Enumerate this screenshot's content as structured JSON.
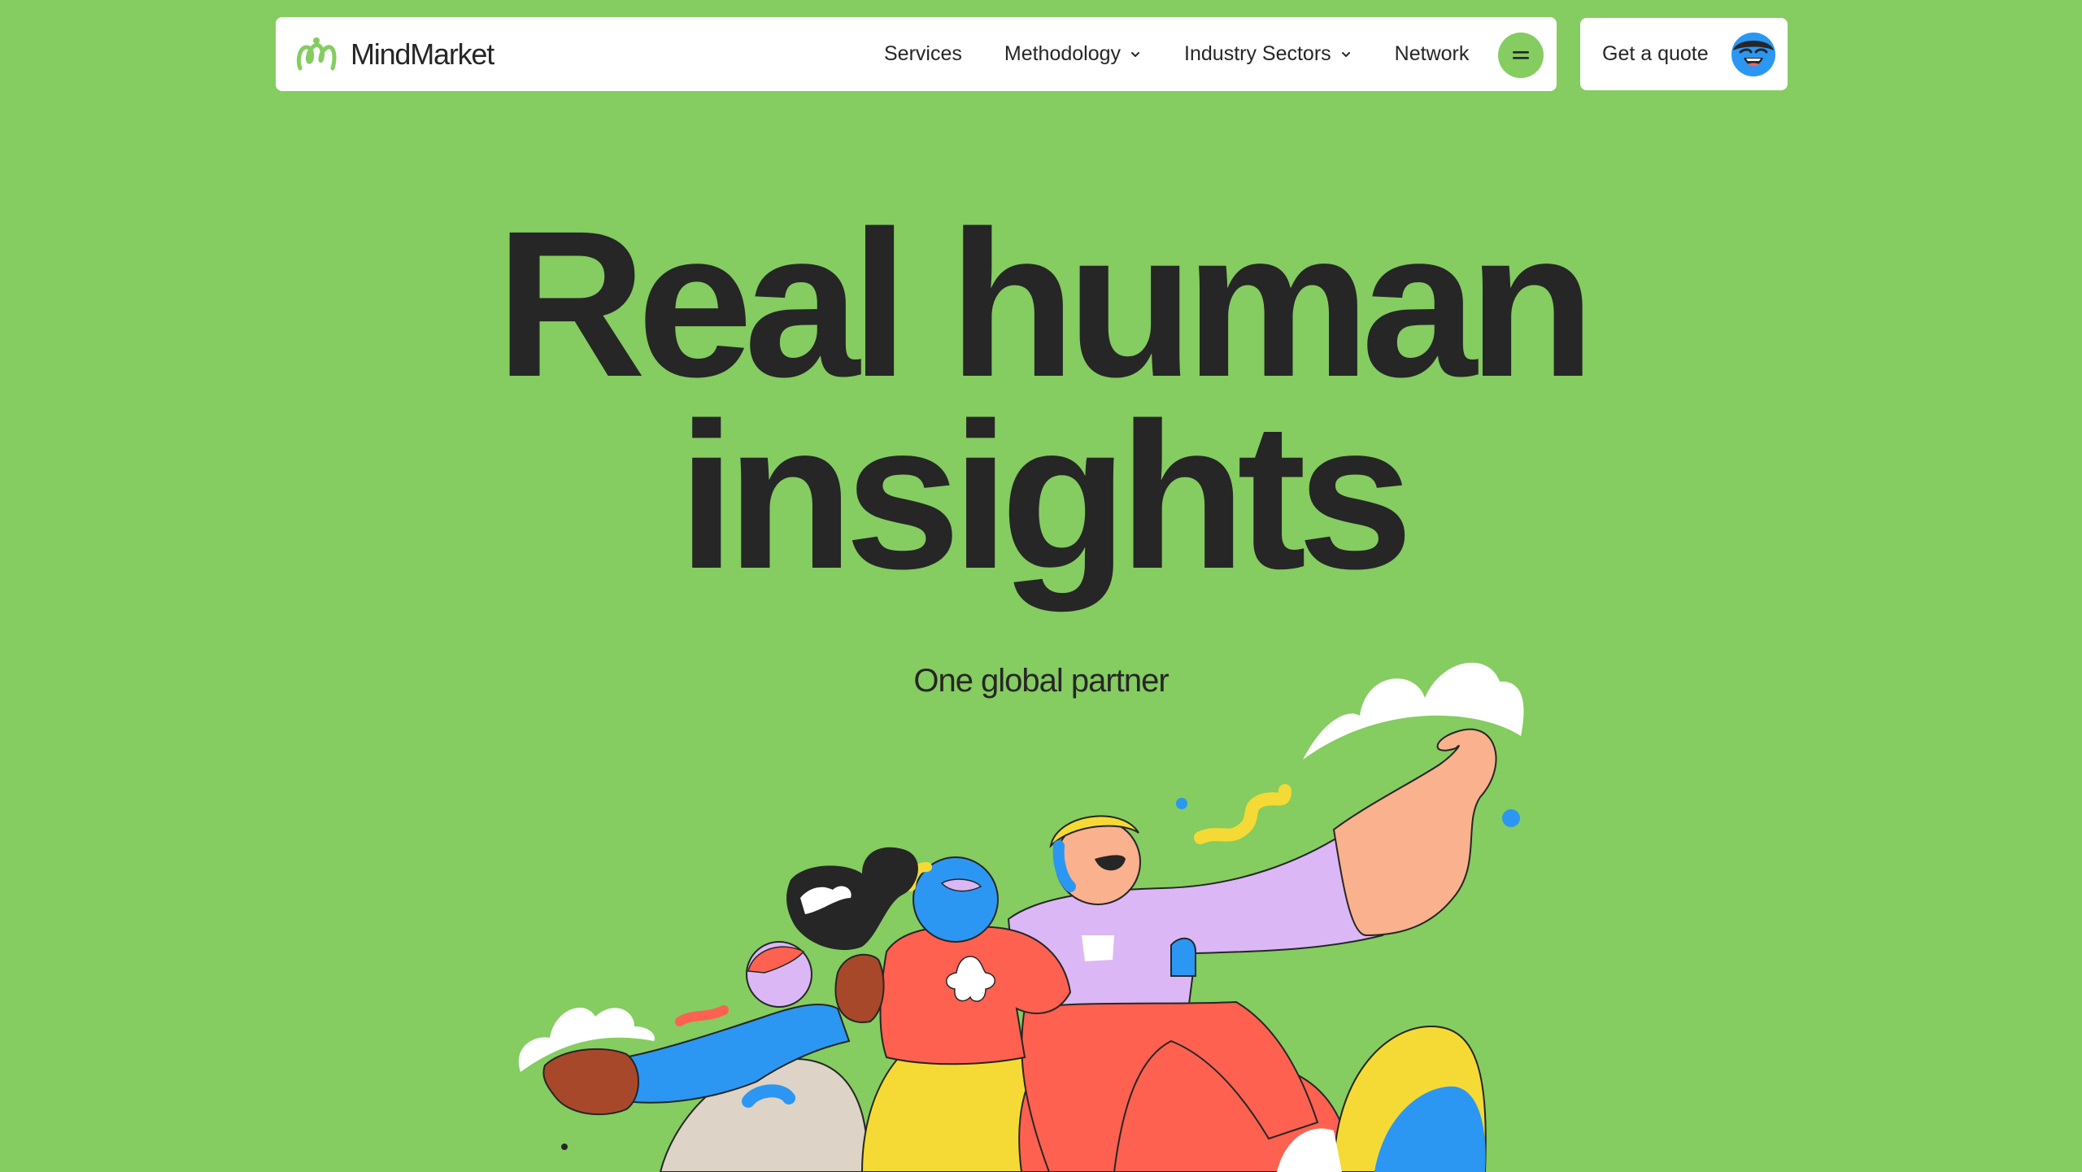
{
  "brand": {
    "name": "MindMarket",
    "logo_icon": "squiggle-logo-icon",
    "color": "#85cc61"
  },
  "nav": {
    "items": [
      {
        "label": "Services",
        "has_dropdown": false
      },
      {
        "label": "Methodology",
        "has_dropdown": true
      },
      {
        "label": "Industry Sectors",
        "has_dropdown": true
      },
      {
        "label": "Network",
        "has_dropdown": false
      }
    ],
    "menu_icon": "hamburger-icon"
  },
  "cta": {
    "label": "Get a quote",
    "avatar_icon": "smiling-face-avatar-icon"
  },
  "hero": {
    "title_line1": "Real human",
    "title_line2": "insights",
    "subtitle": "One global partner"
  },
  "colors": {
    "background": "#85cc61",
    "text": "#262626",
    "surface": "#ffffff",
    "blue": "#2b97f2",
    "red": "#ff6150",
    "yellow": "#f5da35",
    "lilac": "#dbb8f5",
    "peach": "#f9b18e"
  }
}
